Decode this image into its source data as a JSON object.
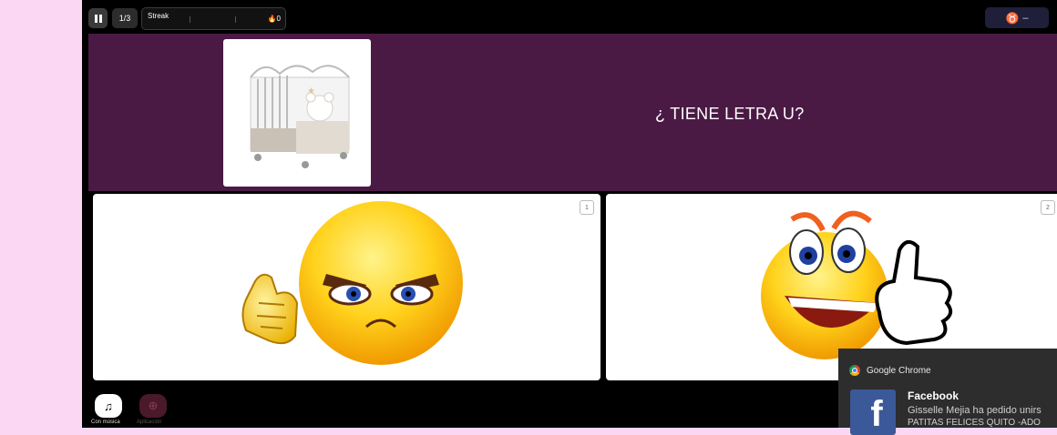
{
  "topbar": {
    "page_indicator": "1/3",
    "streak_label": "Streak",
    "streak_count": "0",
    "streak_icon": "fire-icon",
    "player_icon": "player-icon",
    "player_label": "–"
  },
  "question": {
    "image": "baby-crib-image",
    "text": "¿ TIENE LETRA U?"
  },
  "answers": [
    {
      "number": "1",
      "image": "angry-emoji-thumbs-down-image"
    },
    {
      "number": "2",
      "image": "happy-emoji-thumbs-up-image"
    }
  ],
  "bottombar": {
    "music_label": "Con música",
    "boost_label": "Aplicación"
  },
  "notification": {
    "app": "Google Chrome",
    "title": "Facebook",
    "line1": "Gisselle Mejia ha pedido unirs",
    "line2": "PATITAS FELICES QUITO -ADO"
  },
  "colors": {
    "page_bg": "#fbd7f4",
    "question_bg": "#4a1a44",
    "notification_bg": "#2d2d2d",
    "facebook": "#3b5998"
  }
}
